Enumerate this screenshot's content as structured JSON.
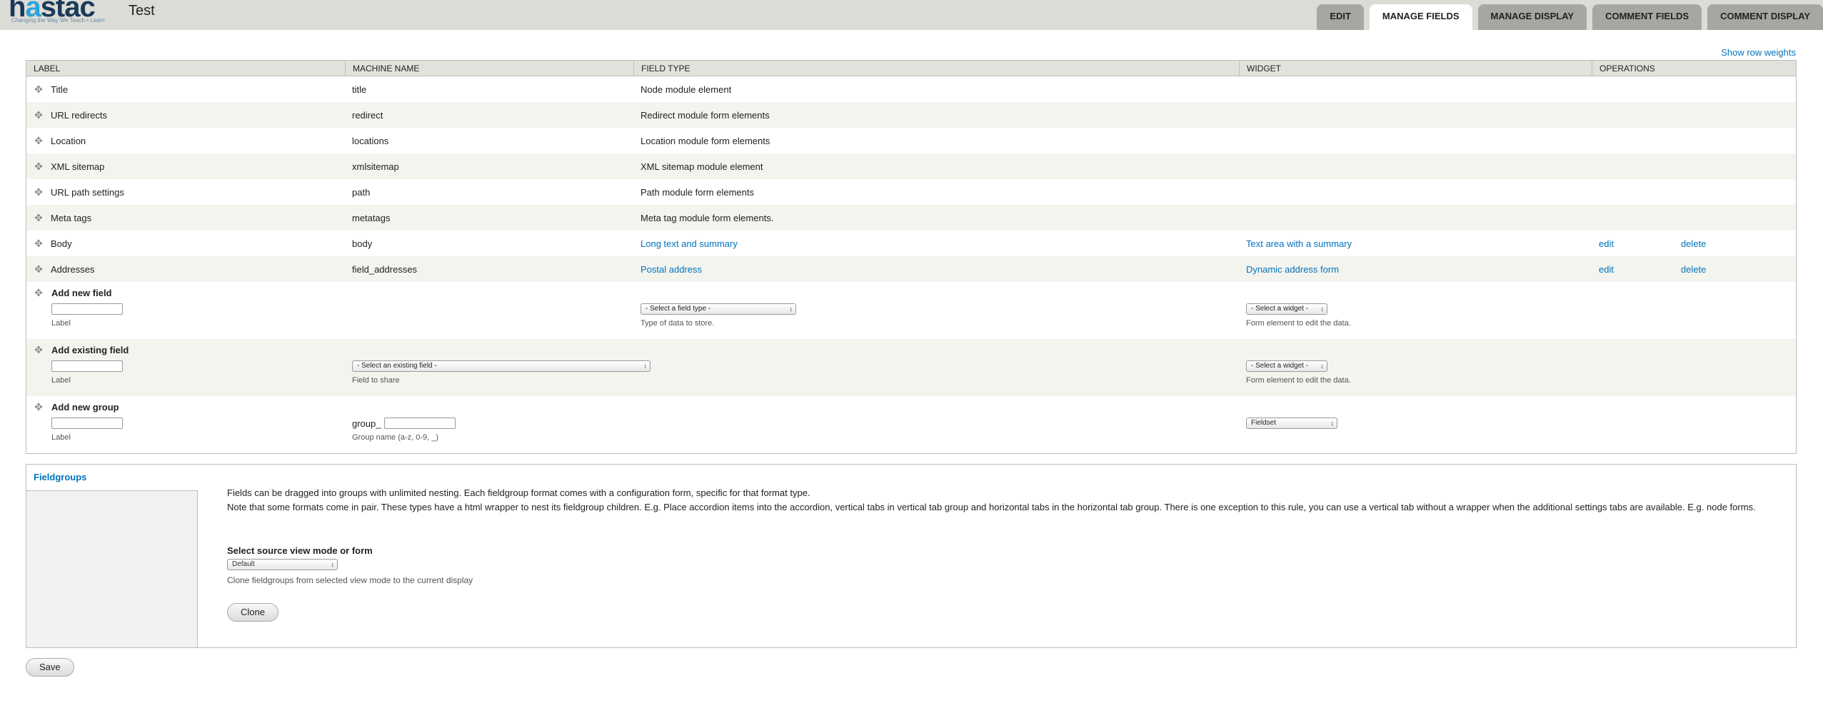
{
  "header": {
    "logo_pre": "h",
    "logo_accent": "a",
    "logo_post": "stac",
    "tagline": "Changing the Way We Teach • Learn",
    "site_title": "Test",
    "tabs": [
      {
        "label": "EDIT",
        "active": false
      },
      {
        "label": "MANAGE FIELDS",
        "active": true
      },
      {
        "label": "MANAGE DISPLAY",
        "active": false
      },
      {
        "label": "COMMENT FIELDS",
        "active": false
      },
      {
        "label": "COMMENT DISPLAY",
        "active": false
      }
    ]
  },
  "show_row_weights": "Show row weights",
  "table": {
    "columns": [
      "LABEL",
      "MACHINE NAME",
      "FIELD TYPE",
      "WIDGET",
      "OPERATIONS"
    ],
    "rows": [
      {
        "label": "Title",
        "machine": "title",
        "type": "Node module element",
        "widget": "",
        "edit": "",
        "delete": ""
      },
      {
        "label": "URL redirects",
        "machine": "redirect",
        "type": "Redirect module form elements",
        "widget": "",
        "edit": "",
        "delete": ""
      },
      {
        "label": "Location",
        "machine": "locations",
        "type": "Location module form elements",
        "widget": "",
        "edit": "",
        "delete": ""
      },
      {
        "label": "XML sitemap",
        "machine": "xmlsitemap",
        "type": "XML sitemap module element",
        "widget": "",
        "edit": "",
        "delete": ""
      },
      {
        "label": "URL path settings",
        "machine": "path",
        "type": "Path module form elements",
        "widget": "",
        "edit": "",
        "delete": ""
      },
      {
        "label": "Meta tags",
        "machine": "metatags",
        "type": "Meta tag module form elements.",
        "widget": "",
        "edit": "",
        "delete": ""
      },
      {
        "label": "Body",
        "machine": "body",
        "type": "Long text and summary",
        "widget": "Text area with a summary",
        "edit": "edit",
        "delete": "delete"
      },
      {
        "label": "Addresses",
        "machine": "field_addresses",
        "type": "Postal address",
        "widget": "Dynamic address form",
        "edit": "edit",
        "delete": "delete"
      }
    ],
    "add_new_field": {
      "title": "Add new field",
      "label_help": "Label",
      "type_select": "- Select a field type -",
      "type_help": "Type of data to store.",
      "widget_select": "- Select a widget -",
      "widget_help": "Form element to edit the data."
    },
    "add_existing_field": {
      "title": "Add existing field",
      "label_help": "Label",
      "field_select": "- Select an existing field -",
      "field_help": "Field to share",
      "widget_select": "- Select a widget -",
      "widget_help": "Form element to edit the data."
    },
    "add_new_group": {
      "title": "Add new group",
      "label_help": "Label",
      "prefix": "group_",
      "name_help": "Group name (a-z, 0-9, _)",
      "format_select": "Fieldset"
    }
  },
  "fieldgroups": {
    "title": "Fieldgroups",
    "para1": "Fields can be dragged into groups with unlimited nesting. Each fieldgroup format comes with a configuration form, specific for that format type.",
    "para2": "Note that some formats come in pair. These types have a html wrapper to nest its fieldgroup children. E.g. Place accordion items into the accordion, vertical tabs in vertical tab group and horizontal tabs in the horizontal tab group. There is one exception to this rule, you can use a vertical tab without a wrapper when the additional settings tabs are available. E.g. node forms.",
    "source_label": "Select source view mode or form",
    "source_select": "Default",
    "source_help": "Clone fieldgroups from selected view mode to the current display",
    "clone_label": "Clone"
  },
  "save_label": "Save",
  "colors": {
    "link": "#0074bd",
    "header_bg": "#dcdcd6",
    "tab_bg": "#a6a7a2"
  }
}
